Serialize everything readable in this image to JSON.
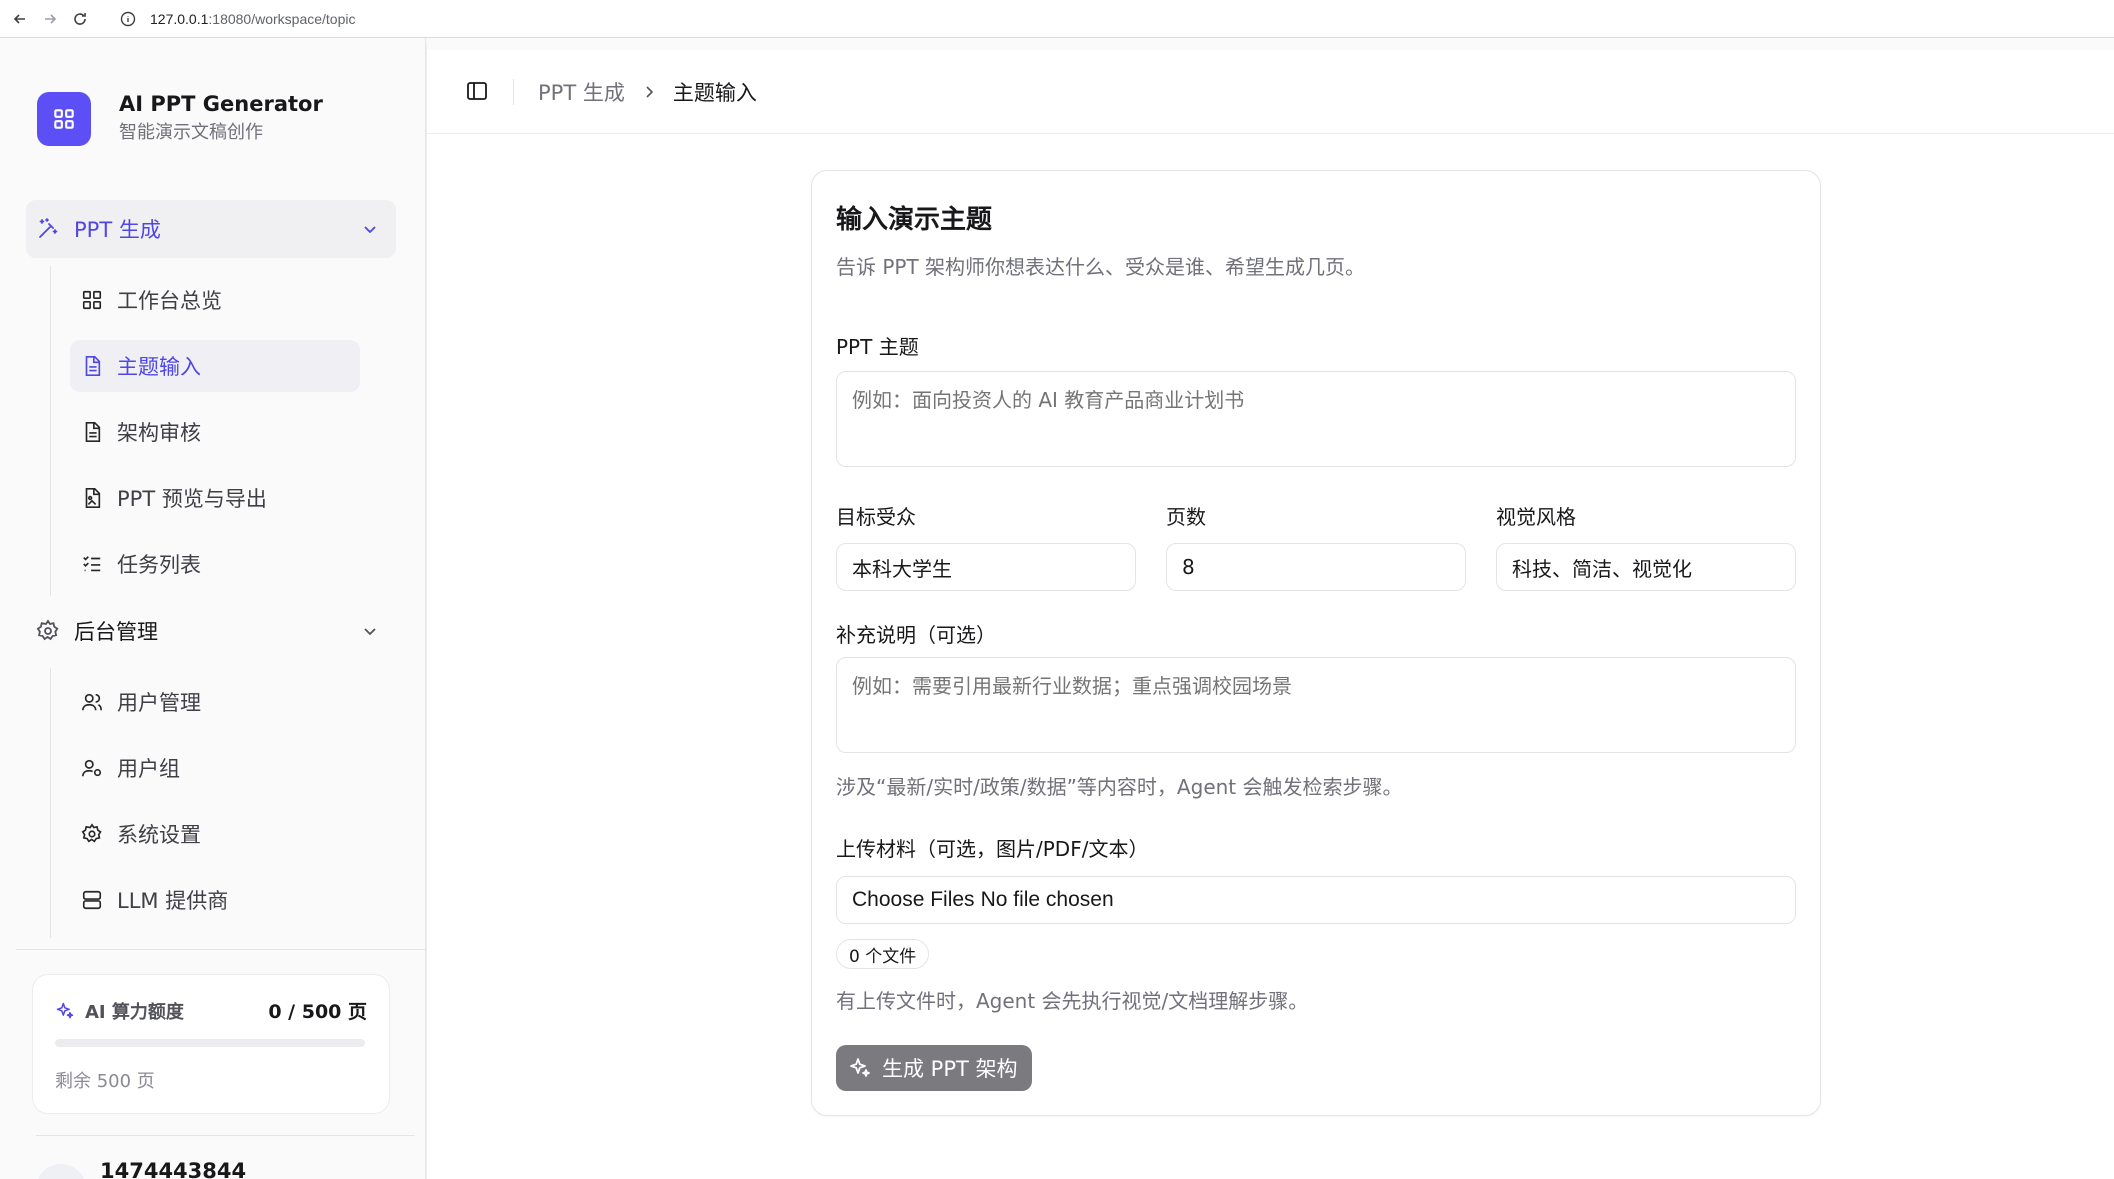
{
  "browser": {
    "url_host": "127.0.0.1",
    "url_path": ":18080/workspace/topic"
  },
  "brand": {
    "title": "AI PPT Generator",
    "subtitle": "智能演示文稿创作"
  },
  "nav": {
    "group1": {
      "label": "PPT 生成",
      "items": [
        {
          "label": "工作台总览",
          "icon": "dashboard-icon"
        },
        {
          "label": "主题输入",
          "icon": "document-icon",
          "active": true
        },
        {
          "label": "架构审核",
          "icon": "document-icon"
        },
        {
          "label": "PPT 预览与导出",
          "icon": "file-image-icon"
        },
        {
          "label": "任务列表",
          "icon": "list-check-icon"
        }
      ]
    },
    "group2": {
      "label": "后台管理",
      "items": [
        {
          "label": "用户管理",
          "icon": "users-icon"
        },
        {
          "label": "用户组",
          "icon": "user-group-icon"
        },
        {
          "label": "系统设置",
          "icon": "gear-icon"
        },
        {
          "label": "LLM 提供商",
          "icon": "server-icon"
        }
      ]
    }
  },
  "quota": {
    "label": "AI 算力额度",
    "value": "0 / 500 页",
    "progress": 0,
    "remaining": "剩余 500 页"
  },
  "user": {
    "name": "1474443844"
  },
  "header": {
    "crumb_parent": "PPT 生成",
    "crumb_current": "主题输入"
  },
  "form": {
    "title": "输入演示主题",
    "description": "告诉 PPT 架构师你想表达什么、受众是谁、希望生成几页。",
    "topic_label": "PPT 主题",
    "topic_placeholder": "例如：面向投资人的 AI 教育产品商业计划书",
    "audience_label": "目标受众",
    "audience_value": "本科大学生",
    "pages_label": "页数",
    "pages_value": "8",
    "style_label": "视觉风格",
    "style_value": "科技、简洁、视觉化",
    "notes_label": "补充说明（可选）",
    "notes_placeholder": "例如：需要引用最新行业数据；重点强调校园场景",
    "notes_hint": "涉及“最新/实时/政策/数据”等内容时，Agent 会触发检索步骤。",
    "upload_label": "上传材料（可选，图片/PDF/文本）",
    "upload_button": "Choose Files",
    "upload_status": "No file chosen",
    "file_count": "0 个文件",
    "upload_hint": "有上传文件时，Agent 会先执行视觉/文档理解步骤。",
    "submit_label": "生成 PPT 架构"
  },
  "colors": {
    "accent": "#4f46e5",
    "brand_logo": "#5b4ff5",
    "disabled_button": "#7a7a7f"
  }
}
